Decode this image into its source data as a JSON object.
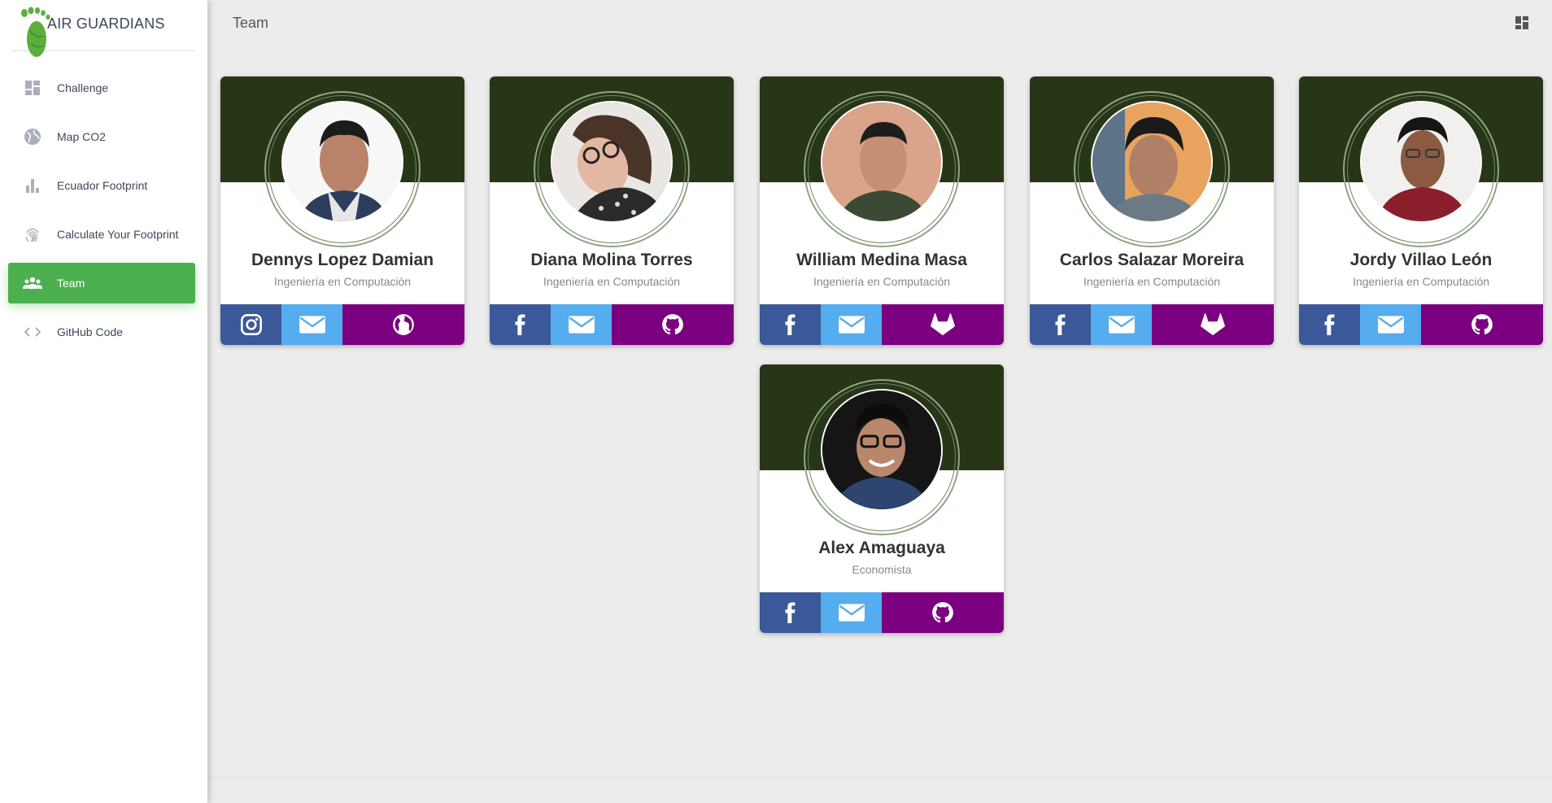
{
  "brand": {
    "name": "AIR GUARDIANS"
  },
  "sidebar": {
    "items": [
      {
        "label": "Challenge",
        "icon": "dashboard-icon",
        "active": false
      },
      {
        "label": "Map CO2",
        "icon": "globe-icon",
        "active": false
      },
      {
        "label": "Ecuador Footprint",
        "icon": "bar-chart-icon",
        "active": false
      },
      {
        "label": "Calculate Your Footprint",
        "icon": "fingerprint-icon",
        "active": false
      },
      {
        "label": "Team",
        "icon": "team-icon",
        "active": true
      },
      {
        "label": "GitHub Code",
        "icon": "code-icon",
        "active": false
      }
    ]
  },
  "header": {
    "title": "Team",
    "action_icon": "apps-icon"
  },
  "colors": {
    "accent": "#4caf50",
    "cover": "#283618",
    "facebook": "#3b5998",
    "email": "#55acee",
    "link": "#7b0080"
  },
  "team": [
    {
      "name": "Dennys Lopez Damian",
      "role": "Ingeniería en Computación",
      "social": [
        "instagram-icon",
        "email-icon",
        "globe-icon"
      ]
    },
    {
      "name": "Diana Molina Torres",
      "role": "Ingeniería en Computación",
      "social": [
        "facebook-icon",
        "email-icon",
        "github-icon"
      ]
    },
    {
      "name": "William Medina Masa",
      "role": "Ingeniería en Computación",
      "social": [
        "facebook-icon",
        "email-icon",
        "gitlab-icon"
      ]
    },
    {
      "name": "Carlos Salazar Moreira",
      "role": "Ingeniería en Computación",
      "social": [
        "facebook-icon",
        "email-icon",
        "gitlab-icon"
      ]
    },
    {
      "name": "Jordy Villao León",
      "role": "Ingeniería en Computación",
      "social": [
        "facebook-icon",
        "email-icon",
        "github-icon"
      ]
    },
    {
      "name": "Alex Amaguaya",
      "role": "Economista",
      "social": [
        "facebook-icon",
        "email-icon",
        "github-icon"
      ]
    }
  ]
}
